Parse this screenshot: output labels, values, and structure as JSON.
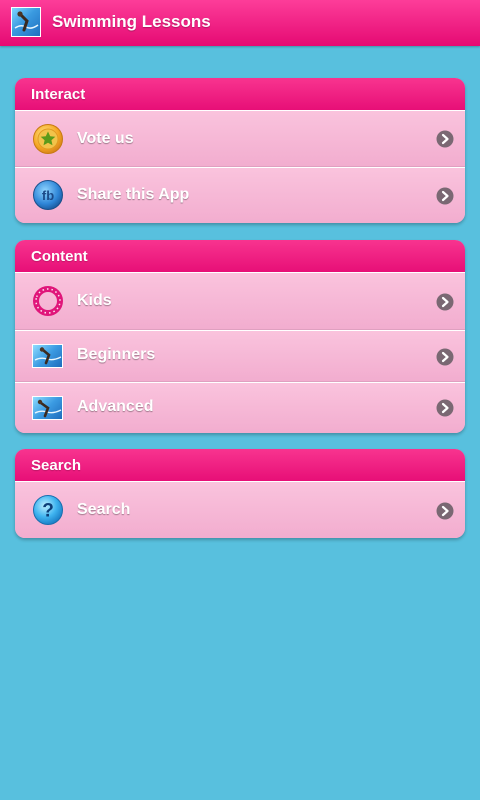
{
  "header": {
    "title": "Swimming Lessons",
    "icon": "swimmer-thumbnail-icon"
  },
  "sections": [
    {
      "title": "Interact",
      "items": [
        {
          "label": "Vote us",
          "icon": "star-coin-icon"
        },
        {
          "label": "Share this App",
          "icon": "facebook-icon"
        }
      ]
    },
    {
      "title": "Content",
      "items": [
        {
          "label": "Kids",
          "icon": "ring-icon"
        },
        {
          "label": "Beginners",
          "icon": "swimmer-thumbnail-icon"
        },
        {
          "label": "Advanced",
          "icon": "swimmer-thumbnail-icon"
        }
      ]
    },
    {
      "title": "Search",
      "items": [
        {
          "label": "Search",
          "icon": "question-icon"
        }
      ]
    }
  ],
  "colors": {
    "background": "#58c0de",
    "accent": "#ec1178",
    "row": "#f5b9d6"
  }
}
